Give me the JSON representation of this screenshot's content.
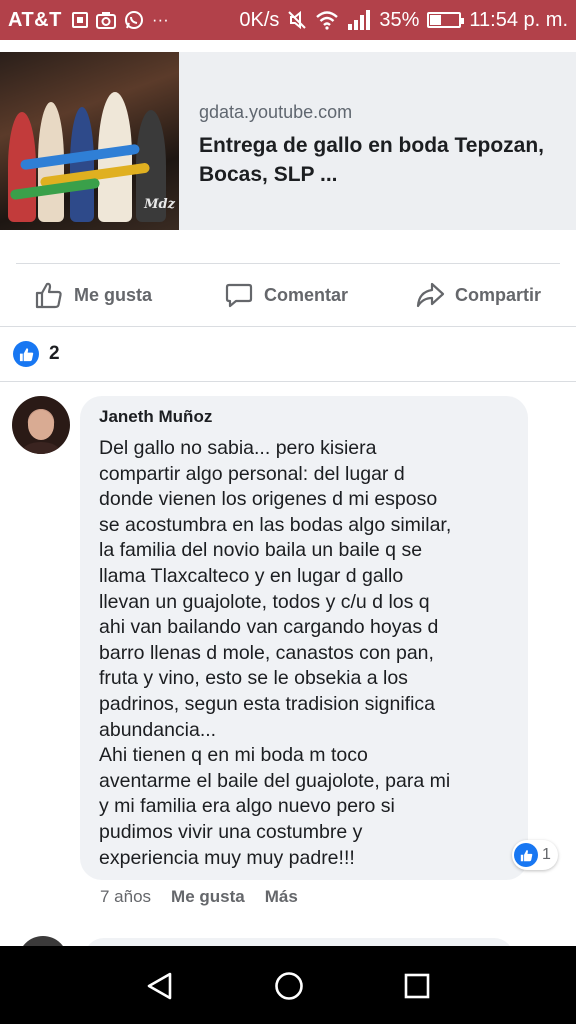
{
  "status_bar": {
    "carrier": "AT&T",
    "icons": [
      "sim-icon",
      "camera-icon",
      "whatsapp-icon",
      "more-dots"
    ],
    "more_glyph": "···",
    "network_speed": "0K/s",
    "battery_percent": "35%",
    "battery_level": 0.35,
    "time": "11:54 p. m.",
    "background": "#b2414a"
  },
  "link_preview": {
    "domain": "gdata.youtube.com",
    "title": "Entrega de gallo en boda Tepozan, Bocas, SLP ...",
    "thumbnail_watermark": "Mdz"
  },
  "actions": {
    "like_label": "Me gusta",
    "comment_label": "Comentar",
    "share_label": "Compartir"
  },
  "reactions": {
    "count": "2"
  },
  "comment": {
    "author": "Janeth Muñoz",
    "text": "Del gallo no sabia... pero kisiera\ncompartir algo personal: del lugar d\ndonde vienen los origenes d mi esposo\nse acostumbra en las bodas algo similar,\nla familia del novio baila un baile q se\nllama Tlaxcalteco y en lugar d gallo\nllevan un guajolote, todos y c/u d los q\nahi van bailando van cargando hoyas d\nbarro llenas d mole, canastos con pan,\nfruta y vino, esto se le obsekia a los\npadrinos, segun esta tradision significa\nabundancia...\nAhi tienen q en mi boda m toco\naventarme el baile del guajolote, para mi\ny mi familia era algo nuevo pero si\npudimos vivir una costumbre y\nexperiencia muy muy padre!!!",
    "reaction_count": "1",
    "time": "7 años",
    "like_label": "Me gusta",
    "more_label": "Más"
  },
  "colors": {
    "accent": "#1877f2",
    "secondary_text": "#65676b",
    "bubble": "#f0f2f5"
  }
}
